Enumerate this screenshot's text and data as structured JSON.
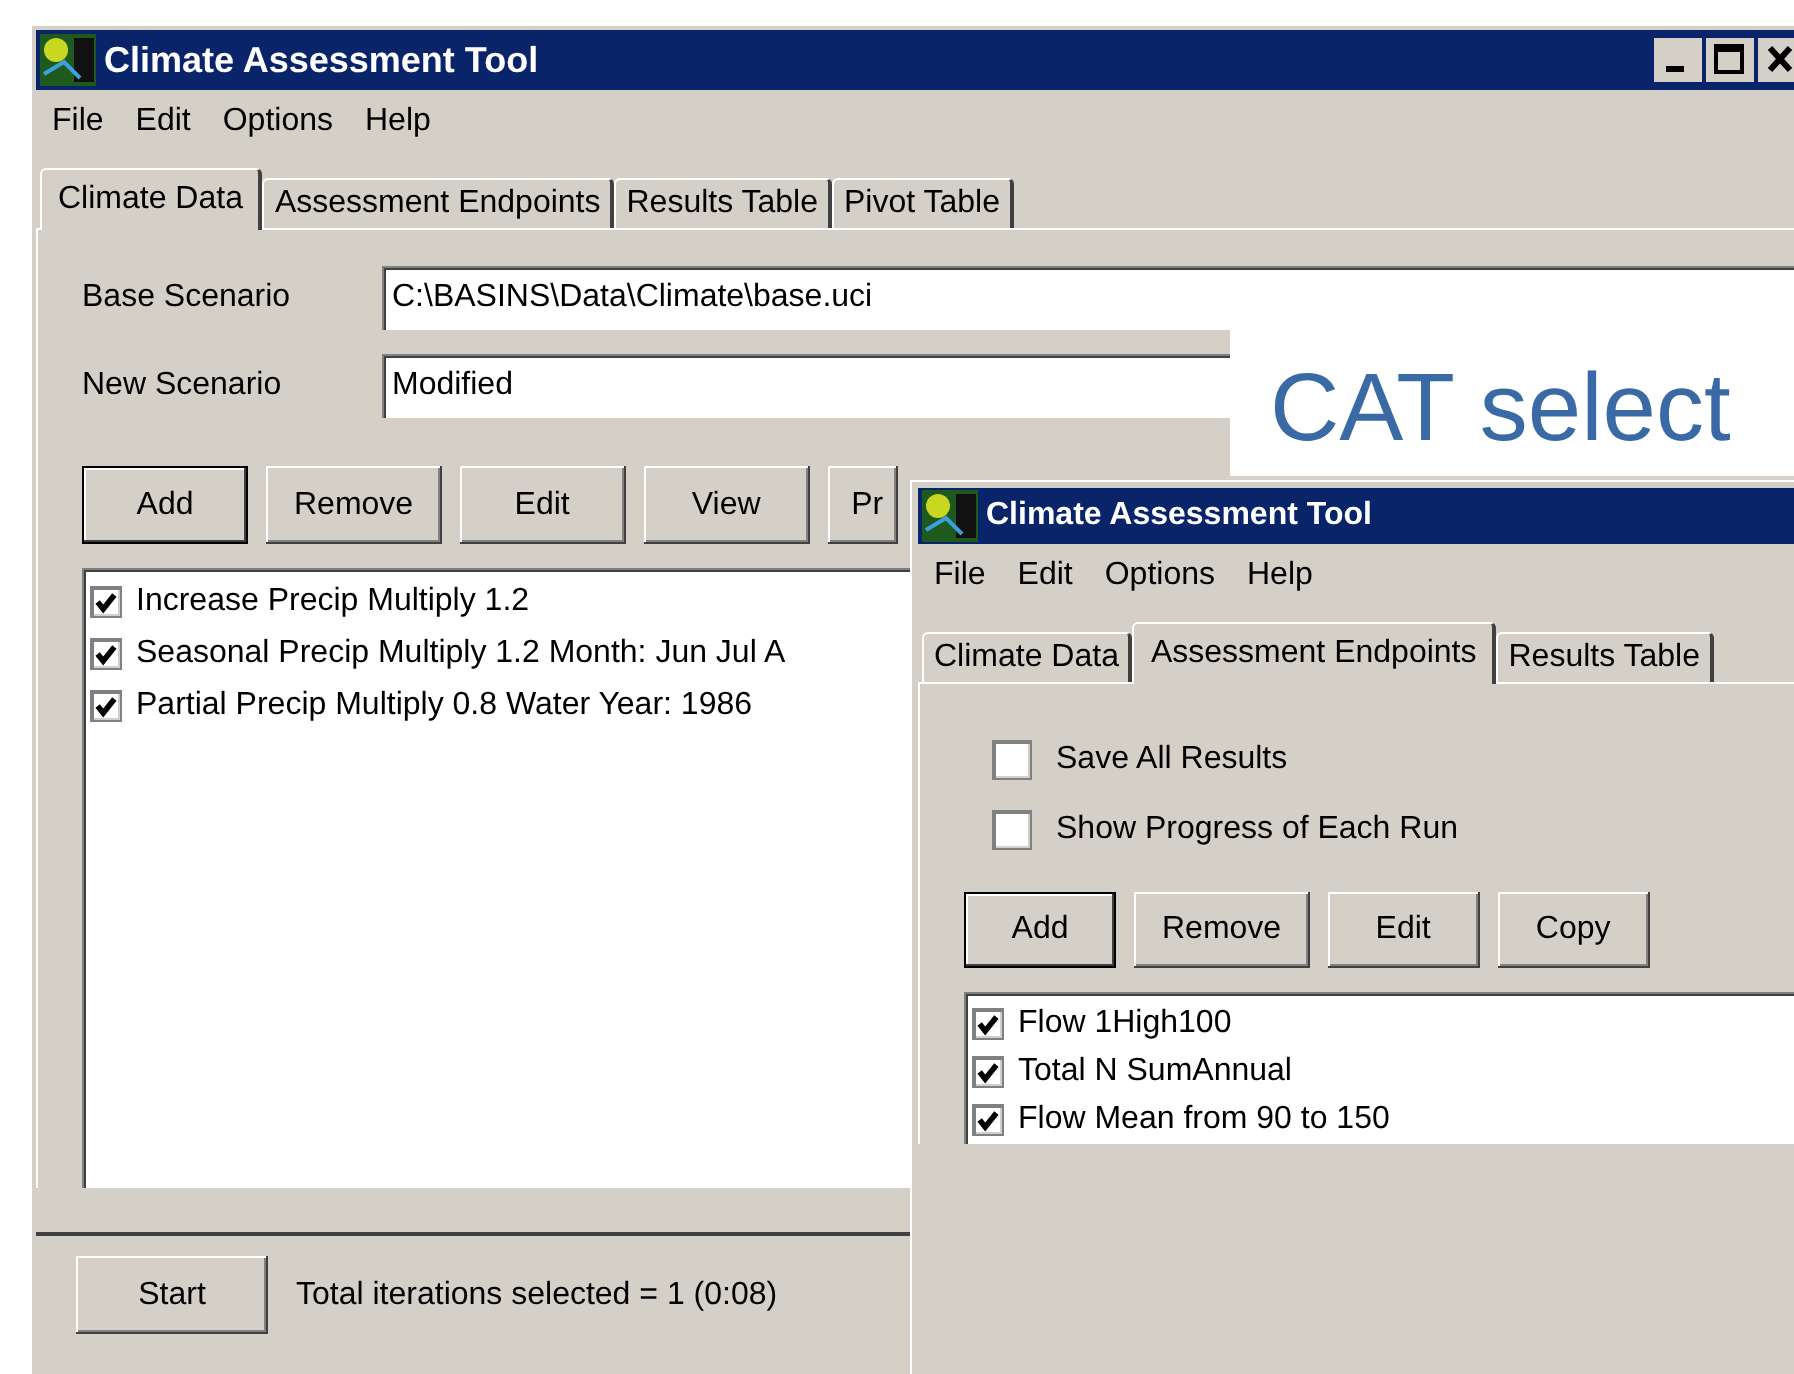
{
  "main_window": {
    "title": "Climate Assessment Tool",
    "menu": [
      "File",
      "Edit",
      "Options",
      "Help"
    ],
    "tabs": [
      {
        "label": "Climate Data",
        "selected": true
      },
      {
        "label": "Assessment Endpoints",
        "selected": false
      },
      {
        "label": "Results Table",
        "selected": false
      },
      {
        "label": "Pivot Table",
        "selected": false
      }
    ],
    "fields": [
      {
        "label": "Base Scenario",
        "value": "C:\\BASINS\\Data\\Climate\\base.uci"
      },
      {
        "label": "New Scenario",
        "value": "Modified"
      }
    ],
    "buttons": [
      {
        "label": "Add",
        "selected": true
      },
      {
        "label": "Remove",
        "selected": false
      },
      {
        "label": "Edit",
        "selected": false
      },
      {
        "label": "View",
        "selected": false
      },
      {
        "label": "Pr",
        "selected": false
      }
    ],
    "items": [
      {
        "label": "Increase Precip Multiply 1.2",
        "checked": true
      },
      {
        "label": "Seasonal Precip Multiply 1.2 Month: Jun Jul A",
        "checked": true
      },
      {
        "label": "Partial Precip Multiply 0.8 Water Year: 1986",
        "checked": true
      }
    ],
    "start_button": "Start",
    "status": "Total iterations selected = 1 (0:08)"
  },
  "slide_title": "CAT select",
  "front_window": {
    "title": "Climate Assessment Tool",
    "menu": [
      "File",
      "Edit",
      "Options",
      "Help"
    ],
    "tabs": [
      {
        "label": "Climate Data",
        "selected": false
      },
      {
        "label": "Assessment Endpoints",
        "selected": true
      },
      {
        "label": "Results Table",
        "selected": false
      }
    ],
    "options": [
      {
        "label": "Save All Results",
        "checked": false
      },
      {
        "label": "Show Progress of Each Run",
        "checked": false
      }
    ],
    "buttons": [
      {
        "label": "Add",
        "selected": true
      },
      {
        "label": "Remove",
        "selected": false
      },
      {
        "label": "Edit",
        "selected": false
      },
      {
        "label": "Copy",
        "selected": false
      }
    ],
    "items": [
      {
        "label": "Flow 1High100",
        "checked": true
      },
      {
        "label": "Total N SumAnnual",
        "checked": true
      },
      {
        "label": "Flow Mean from 90 to 150",
        "checked": true
      }
    ]
  }
}
